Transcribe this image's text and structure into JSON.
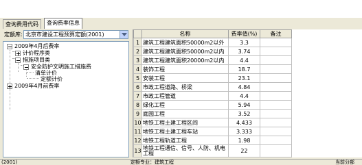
{
  "tabs": [
    {
      "label": "查询费用代码"
    },
    {
      "label": "查询费率信息"
    }
  ],
  "quota": {
    "label": "定额库:",
    "value": "北京市建设工程预算定额(2001)"
  },
  "tree": {
    "items": [
      {
        "label": "2009年4月后费率"
      },
      {
        "label": "计价程序类"
      },
      {
        "label": "措施项目类"
      },
      {
        "label": "安全防护文明施工措施费"
      },
      {
        "label": "清单计价"
      },
      {
        "label": "定额计价"
      },
      {
        "label": "2009年4月前费率"
      }
    ]
  },
  "grid": {
    "columns": [
      "名称",
      "费率值(%)",
      "备注"
    ],
    "rows": [
      {
        "num": "1",
        "name": "建筑工程建筑面积50000m2以外",
        "rate": "3.3",
        "note": ""
      },
      {
        "num": "2",
        "name": "建筑工程建筑面积50000m2以内",
        "rate": "3.74",
        "note": ""
      },
      {
        "num": "3",
        "name": "建筑工程建筑面积20000m2以内",
        "rate": "4.4",
        "note": ""
      },
      {
        "num": "4",
        "name": "装饰工程",
        "rate": "18.7",
        "note": ""
      },
      {
        "num": "5",
        "name": "安装工程",
        "rate": "23.1",
        "note": ""
      },
      {
        "num": "6",
        "name": "市政工程道路、桥梁",
        "rate": "4.84",
        "note": ""
      },
      {
        "num": "7",
        "name": "市政工程管道",
        "rate": "4.4",
        "note": ""
      },
      {
        "num": "8",
        "name": "绿化工程",
        "rate": "5.94",
        "note": ""
      },
      {
        "num": "9",
        "name": "庭园工程",
        "rate": "3.52",
        "note": ""
      },
      {
        "num": "10",
        "name": "地铁工程土建工程区间",
        "rate": "4.433",
        "note": ""
      },
      {
        "num": "11",
        "name": "地铁工程土建工程车站",
        "rate": "3.333",
        "note": ""
      },
      {
        "num": "12",
        "name": "地铁工程轨道工程",
        "rate": "1.98",
        "note": ""
      },
      {
        "num": "13",
        "name": "地铁工程通信、信号、人防、机电工程",
        "rate": "22",
        "note": ""
      }
    ]
  },
  "status": {
    "left": "(2001)",
    "middle": "定额专业：建筑工程",
    "right": "当前分部"
  },
  "colors": {
    "background": "#ece9d8",
    "panel_border": "#7f9db9"
  }
}
